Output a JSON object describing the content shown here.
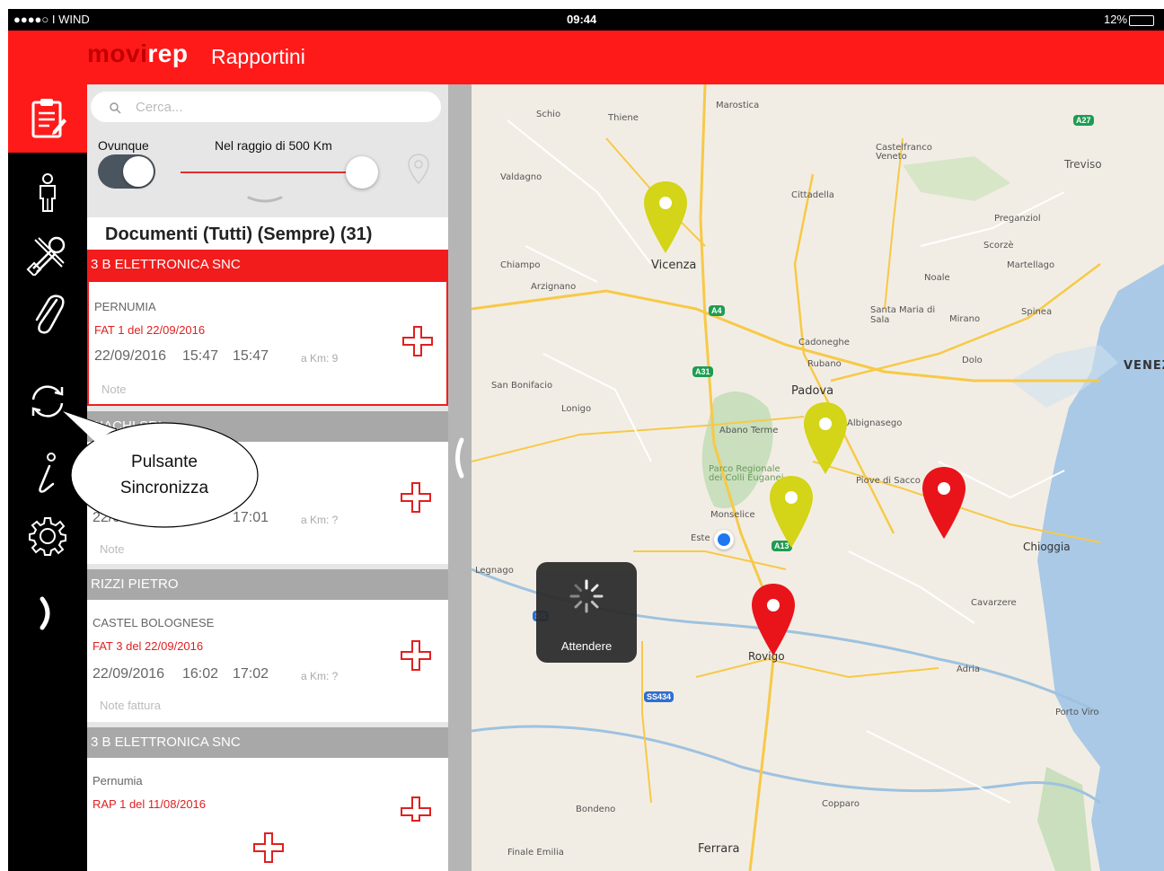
{
  "status_bar": {
    "carrier": "●●●●○ I WIND",
    "time": "09:44",
    "battery": "12%"
  },
  "header": {
    "brand_part1": "movi",
    "brand_part2": "rep",
    "title": "Rapportini"
  },
  "sidebar": {
    "items": [
      {
        "name": "reports-icon",
        "active": true
      },
      {
        "name": "person-icon"
      },
      {
        "name": "tools-icon"
      },
      {
        "name": "attachment-icon"
      },
      {
        "name": "sync-icon"
      },
      {
        "name": "info-icon"
      },
      {
        "name": "settings-icon"
      },
      {
        "name": "expand-chevron-icon"
      }
    ]
  },
  "search": {
    "placeholder": "Cerca..."
  },
  "filters": {
    "scope_label": "Ovunque",
    "radius_label": "Nel raggio di 500 Km",
    "scope_on": true
  },
  "list": {
    "title": "Documenti (Tutti) (Sempre) (31)",
    "groups": [
      {
        "customer": "3 B ELETTRONICA SNC",
        "active": true,
        "items": [
          {
            "client": "PERNUMIA",
            "doc": "FAT 1 del 22/09/2016",
            "date": "22/09/2016",
            "start": "15:47",
            "end": "15:47",
            "km": "a Km: 9",
            "note": "Note"
          }
        ]
      },
      {
        "customer": "BIACHI SRL",
        "items": [
          {
            "client": "",
            "doc": "",
            "date": "22/0",
            "start": "",
            "end": "17:01",
            "km": "a Km: ?",
            "note": "Note"
          }
        ]
      },
      {
        "customer": "RIZZI PIETRO",
        "items": [
          {
            "client": "CASTEL BOLOGNESE",
            "doc": "FAT 3 del 22/09/2016",
            "date": "22/09/2016",
            "start": "16:02",
            "end": "17:02",
            "km": "a Km: ?",
            "note": "Note fattura"
          }
        ]
      },
      {
        "customer": "3 B ELETTRONICA SNC",
        "items": [
          {
            "client": "Pernumia",
            "doc": "RAP 1 del 11/08/2016",
            "date": "",
            "start": "",
            "end": "",
            "km": "",
            "note": ""
          }
        ]
      }
    ]
  },
  "map": {
    "places": [
      "Schio",
      "Thiene",
      "Marostica",
      "Castelfranco Veneto",
      "Treviso",
      "Valdagno",
      "Cittadella",
      "Preganziol",
      "Scorzè",
      "Martellago",
      "Chiampo",
      "Arzignano",
      "Vicenza",
      "Noale",
      "Santa Maria di Sala",
      "Mirano",
      "Spinea",
      "Cadoneghe",
      "Rubano",
      "Dolo",
      "San Bonifacio",
      "Lonigo",
      "Padova",
      "Abano Terme",
      "Albignasego",
      "Parco Regionale dei Colli Euganei",
      "Piove di Sacco",
      "Monselice",
      "Este",
      "Chioggia",
      "Legnago",
      "Cavarzere",
      "Rovigo",
      "Adria",
      "Porto Viro",
      "Copparo",
      "Bondeno",
      "Finale Emilia",
      "Ferrara",
      "VENEZIA"
    ],
    "road_badges": [
      "A27",
      "A4",
      "A31",
      "A13",
      "SS434",
      "SS"
    ],
    "loading_text": "Attendere"
  },
  "callout": {
    "line1": "Pulsante",
    "line2": "Sincronizza"
  },
  "colors": {
    "brand_red": "#ff1a1a",
    "pin_red": "#e8141a",
    "pin_yellow": "#d4d418",
    "location_blue": "#1e78f0"
  }
}
